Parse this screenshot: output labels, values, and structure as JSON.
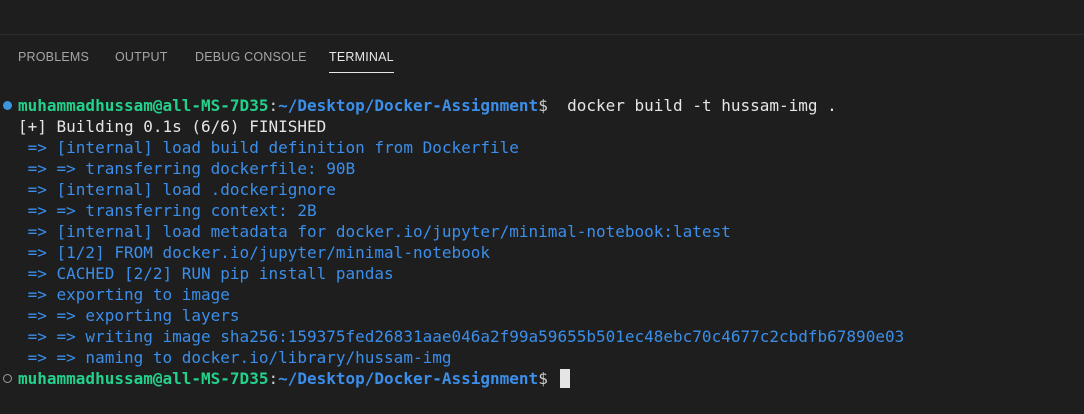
{
  "panel": {
    "tabs": [
      {
        "label": "PROBLEMS",
        "active": false
      },
      {
        "label": "OUTPUT",
        "active": false
      },
      {
        "label": "DEBUG CONSOLE",
        "active": false
      },
      {
        "label": "TERMINAL",
        "active": true
      }
    ]
  },
  "terminal": {
    "prompt_user": "muhammadhussam@all-MS-7D35",
    "prompt_sep": ":",
    "prompt_path": "~/Desktop/Docker-Assignment",
    "prompt_dollar": "$",
    "command": "  docker build -t hussam-img .",
    "build_header": "[+] Building 0.1s (6/6) FINISHED",
    "steps": [
      " => [internal] load build definition from Dockerfile",
      " => => transferring dockerfile: 90B",
      " => [internal] load .dockerignore",
      " => => transferring context: 2B",
      " => [internal] load metadata for docker.io/jupyter/minimal-notebook:latest",
      " => [1/2] FROM docker.io/jupyter/minimal-notebook",
      " => CACHED [2/2] RUN pip install pandas",
      " => exporting to image",
      " => => exporting layers",
      " => => writing image sha256:159375fed26831aae046a2f99a59655b501ec48ebc70c4677c2cbdfb67890e03",
      " => => naming to docker.io/library/hussam-img"
    ]
  },
  "colors": {
    "background": "#1e1e1e",
    "prompt_user": "#23d18b",
    "prompt_path": "#3b8eea",
    "output_blue": "#3b8eea",
    "decoration_success": "#3a96dd",
    "decoration_idle": "#9d9d9d"
  },
  "icons": {
    "command_success": "filled-circle-icon",
    "command_pending": "hollow-circle-icon"
  }
}
